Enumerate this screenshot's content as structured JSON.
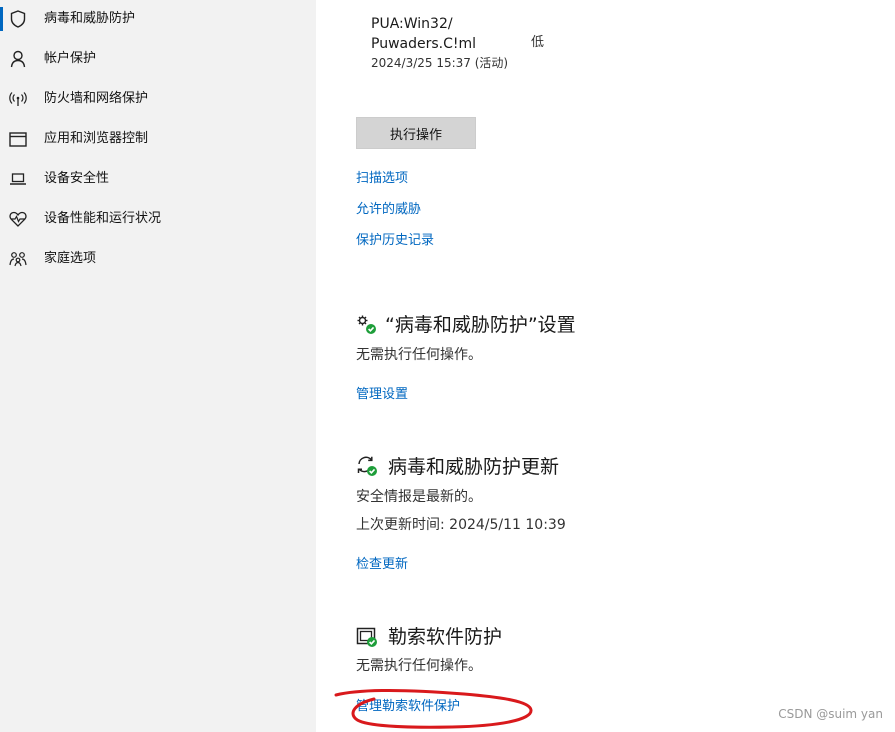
{
  "sidebar": {
    "items": [
      {
        "label": "病毒和威胁防护",
        "icon": "shield-icon",
        "active": true
      },
      {
        "label": "帐户保护",
        "icon": "person-icon"
      },
      {
        "label": "防火墙和网络保护",
        "icon": "antenna-icon"
      },
      {
        "label": "应用和浏览器控制",
        "icon": "window-icon"
      },
      {
        "label": "设备安全性",
        "icon": "laptop-icon"
      },
      {
        "label": "设备性能和运行状况",
        "icon": "heart-icon"
      },
      {
        "label": "家庭选项",
        "icon": "family-icon"
      }
    ]
  },
  "threat": {
    "name_line1": "PUA:Win32/",
    "name_line2": "Puwaders.C!ml",
    "severity": "低",
    "datetime": "2024/3/25 15:37 (活动)"
  },
  "action_button": "执行操作",
  "links": {
    "scan_options": "扫描选项",
    "allowed_threats": "允许的威胁",
    "protection_history": "保护历史记录"
  },
  "settings_section": {
    "title": "“病毒和威胁防护”设置",
    "status": "无需执行任何操作。",
    "link": "管理设置"
  },
  "updates_section": {
    "title": "病毒和威胁防护更新",
    "status": "安全情报是最新的。",
    "last_update": "上次更新时间: 2024/5/11 10:39",
    "link": "检查更新"
  },
  "ransomware_section": {
    "title": "勒索软件防护",
    "status": "无需执行任何操作。",
    "link": "管理勒索软件保护"
  },
  "watermark": "CSDN @suim yan",
  "colors": {
    "link": "#0067c0",
    "sidebar_bg": "#f2f2f2",
    "button_bg": "#d4d4d4",
    "annotation": "#d9191c",
    "status_ok": "#1e9e3a"
  }
}
